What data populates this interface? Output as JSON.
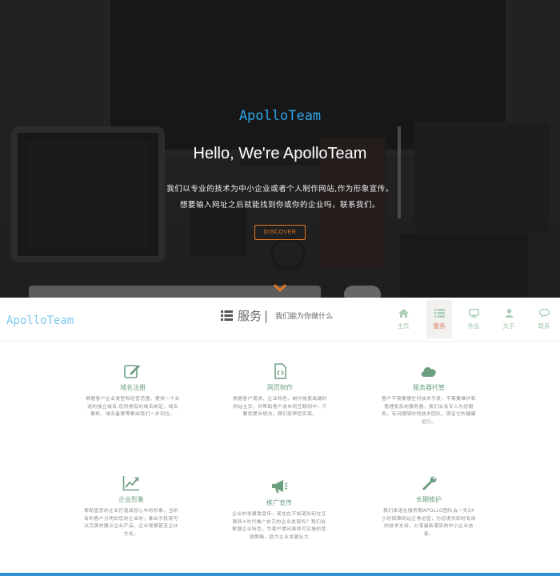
{
  "hero": {
    "brand": "ApolloTeam",
    "title": "Hello, We're ApolloTeam",
    "line1": "我们以专业的技术为中小企业或者个人制作网站,作为形象宣传。",
    "line2": "想要输入网址之后就能找到你或你的企业吗，联系我们。",
    "discover_label": "DISCOVER",
    "accent_color": "#e8781e",
    "brand_color": "#2fa3e8"
  },
  "nav": {
    "logo": "ApolloTeam",
    "section_icon": "list-icon",
    "section_title": "服务",
    "section_separator": "|",
    "section_subtitle": "我们能为你做什么",
    "items": [
      {
        "label": "主页",
        "icon": "home-icon",
        "active": false
      },
      {
        "label": "服务",
        "icon": "list-icon",
        "active": true
      },
      {
        "label": "作品",
        "icon": "monitor-icon",
        "active": false
      },
      {
        "label": "关于",
        "icon": "user-icon",
        "active": false
      },
      {
        "label": "联系",
        "icon": "chat-icon",
        "active": false
      }
    ],
    "item_color": "#9bc6a9",
    "active_color": "#e07a62"
  },
  "services": [
    {
      "title": "域名注册",
      "icon": "edit-icon",
      "desc": "根据客户企业类型和经营范围，提供一个合适的独立域名,您所拥有的域名绑定、域名解析、域名备案等都由我们一步到位。"
    },
    {
      "title": "网页制作",
      "icon": "code-file-icon",
      "desc": "根据客户需求，企业特色，制作独美高端的网站主页，并帮助客户发布到互联网中，只要您提出想法，我们就帮您实现。"
    },
    {
      "title": "服务器托管",
      "icon": "cloud-icon",
      "desc": "客户不需要懂任何技术手段，不需要维护和管理复杂的服务器，我们会有专人为您服务，有问题随时找技术团队，保证它的健康运行。"
    },
    {
      "title": "企业形象",
      "icon": "chart-icon",
      "desc": "帮助宣您的企业打造成您心中的形象，当所有的客户分明白您的企业时，拿出手机就可以完美的展示企业产品、企业规模甚至企业文化。"
    },
    {
      "title": "推广宣传",
      "icon": "megaphone-icon",
      "desc": "企业的发展靠宣传，现在在不知道如何在互联网+时代推广自己的企业发现吗？我们会根据企业特色，为客户提出具体可实施的营销策略，助力企业发展壮大"
    },
    {
      "title": "长期维护",
      "icon": "wrench-icon",
      "desc": "我们承诺在服务期APOLLO团队会一天24小时保障网站正常运营，为您提供即时有效的技术支持，分享最新潮流的中小企业信息。"
    }
  ],
  "service_color": "#6c9e80"
}
